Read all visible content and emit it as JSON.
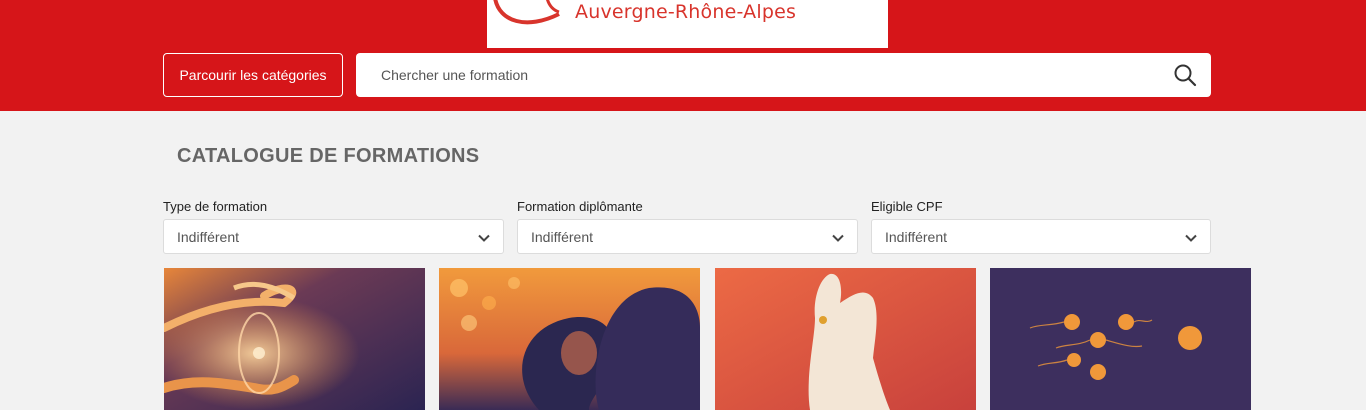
{
  "header": {
    "logo_text": "Auvergne-Rhône-Alpes",
    "browse_label": "Parcourir les catégories",
    "search_placeholder": "Chercher une formation"
  },
  "main": {
    "title": "CATALOGUE DE FORMATIONS",
    "filters": [
      {
        "label": "Type de formation",
        "value": "Indifférent"
      },
      {
        "label": "Formation diplômante",
        "value": "Indifférent"
      },
      {
        "label": "Eligible CPF",
        "value": "Indifférent"
      }
    ]
  },
  "colors": {
    "brand_red": "#d61519",
    "background": "#f2f2f2"
  }
}
